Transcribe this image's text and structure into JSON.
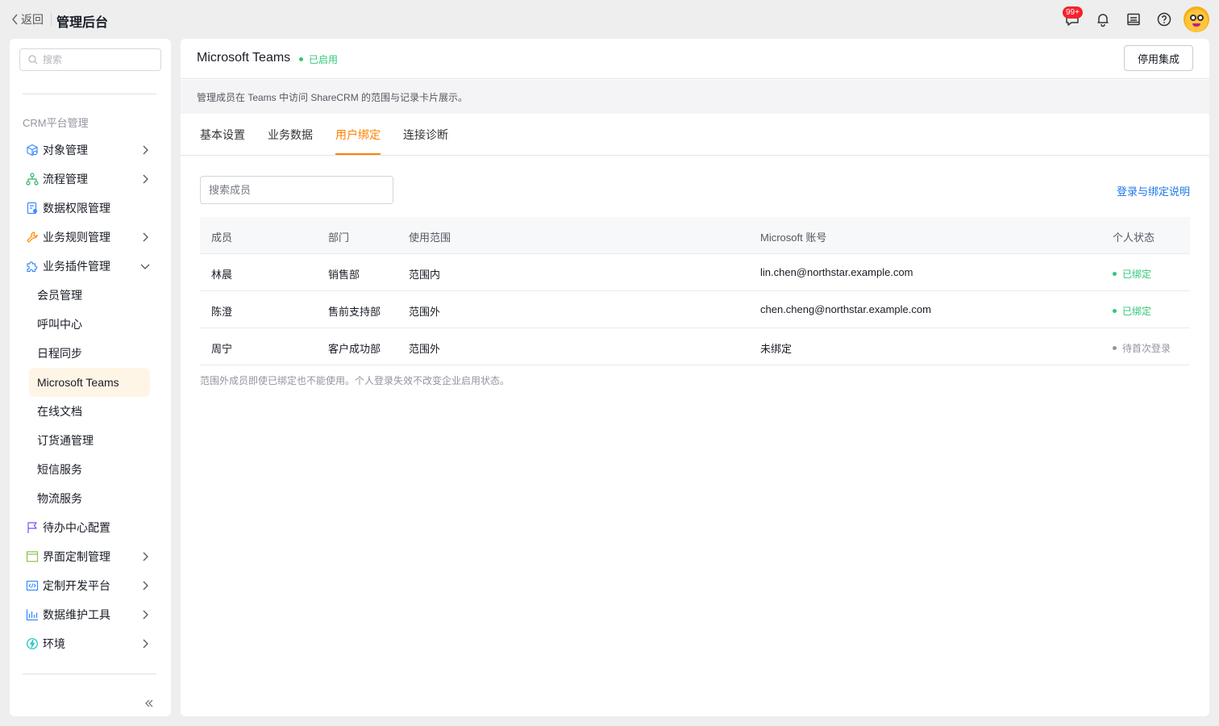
{
  "topbar": {
    "back_label": "返回",
    "app_title": "管理后台",
    "message_badge": "99+",
    "icons": [
      "message-icon",
      "bell-icon",
      "notebook-icon",
      "help-icon",
      "avatar"
    ]
  },
  "sidebar": {
    "search_placeholder": "搜索",
    "section_title": "CRM平台管理",
    "items": [
      {
        "label": "对象管理",
        "icon": "cube-icon",
        "chevron": "right"
      },
      {
        "label": "流程管理",
        "icon": "flow-icon",
        "chevron": "right"
      },
      {
        "label": "数据权限管理",
        "icon": "data-permission-icon",
        "chevron": ""
      },
      {
        "label": "业务规则管理",
        "icon": "wrench-icon",
        "chevron": "right"
      },
      {
        "label": "业务插件管理",
        "icon": "puzzle-icon",
        "chevron": "down"
      }
    ],
    "sub_items": [
      "会员管理",
      "呼叫中心",
      "日程同步",
      "Microsoft Teams",
      "在线文档",
      "订货通管理",
      "短信服务",
      "物流服务"
    ],
    "active_sub_item": "Microsoft Teams",
    "items_after": [
      {
        "label": "待办中心配置",
        "icon": "flag-icon",
        "chevron": ""
      },
      {
        "label": "界面定制管理",
        "icon": "layout-icon",
        "chevron": "right"
      },
      {
        "label": "定制开发平台",
        "icon": "code-icon",
        "chevron": "right"
      },
      {
        "label": "数据维护工具",
        "icon": "bar-chart-icon",
        "chevron": "right"
      },
      {
        "label": "环境",
        "icon": "environment-icon",
        "chevron": "right"
      }
    ]
  },
  "page": {
    "title": "Microsoft Teams",
    "status": "已启用",
    "disable_button": "停用集成",
    "description": "管理成员在 Teams 中访问 ShareCRM 的范围与记录卡片展示。",
    "tabs": [
      "基本设置",
      "业务数据",
      "用户绑定",
      "连接诊断"
    ],
    "active_tab": "用户绑定",
    "member_search_placeholder": "搜索成员",
    "help_link": "登录与绑定说明",
    "table": {
      "headers": [
        "成员",
        "部门",
        "使用范围",
        "Microsoft 账号",
        "个人状态"
      ],
      "rows": [
        {
          "member": "林晨",
          "department": "销售部",
          "scope": "范围内",
          "account": "lin.chen@northstar.example.com",
          "status": "已绑定",
          "status_color": "#30c776"
        },
        {
          "member": "陈澄",
          "department": "售前支持部",
          "scope": "范围外",
          "account": "chen.cheng@northstar.example.com",
          "status": "已绑定",
          "status_color": "#30c776"
        },
        {
          "member": "周宁",
          "department": "客户成功部",
          "scope": "范围外",
          "account": "未绑定",
          "status": "待首次登录",
          "status_color": "#91959e"
        }
      ]
    },
    "note": "范围外成员即使已绑定也不能使用。个人登录失效不改变企业启用状态。"
  },
  "colors": {
    "accent": "#ff8000",
    "link": "#1a78ea",
    "enabled_green": "#30c776",
    "badge_red": "#f5222d",
    "active_nav_bg": "#fff5e6"
  }
}
